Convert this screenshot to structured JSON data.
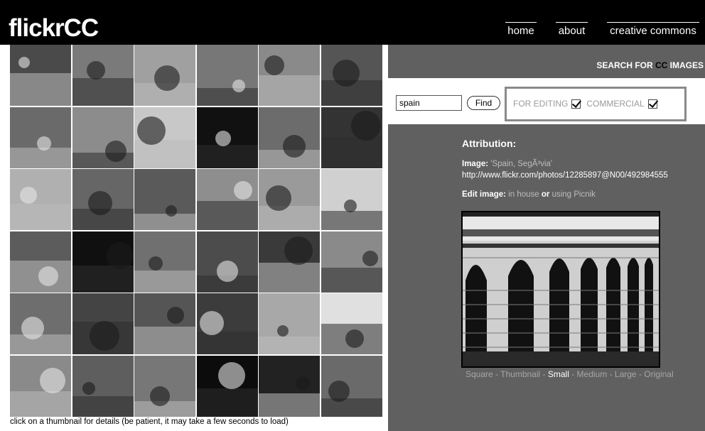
{
  "header": {
    "logo": "flickrCC",
    "nav": [
      {
        "label": "home"
      },
      {
        "label": "about"
      },
      {
        "label": "creative commons"
      }
    ]
  },
  "gallery": {
    "footer_note": "click on a thumbnail for details (be patient, it may take a few seconds to load)",
    "tiles": [
      {
        "tone": "#4a4a4a"
      },
      {
        "tone": "#7a7a7a"
      },
      {
        "tone": "#a0a0a0"
      },
      {
        "tone": "#777777"
      },
      {
        "tone": "#8a8a8a"
      },
      {
        "tone": "#555555"
      },
      {
        "tone": "#6a6a6a"
      },
      {
        "tone": "#8c8c8c"
      },
      {
        "tone": "#c8c8c8"
      },
      {
        "tone": "#111111"
      },
      {
        "tone": "#6c6c6c"
      },
      {
        "tone": "#333333"
      },
      {
        "tone": "#b0b0b0"
      },
      {
        "tone": "#666666"
      },
      {
        "tone": "#5a5a5a"
      },
      {
        "tone": "#8e8e8e"
      },
      {
        "tone": "#9a9a9a"
      },
      {
        "tone": "#d0d0d0"
      },
      {
        "tone": "#5c5c5c"
      },
      {
        "tone": "#101010"
      },
      {
        "tone": "#707070"
      },
      {
        "tone": "#4c4c4c"
      },
      {
        "tone": "#3a3a3a"
      },
      {
        "tone": "#8a8a8a"
      },
      {
        "tone": "#6e6e6e"
      },
      {
        "tone": "#444444"
      },
      {
        "tone": "#555555"
      },
      {
        "tone": "#3c3c3c"
      },
      {
        "tone": "#a8a8a8"
      },
      {
        "tone": "#e0e0e0"
      },
      {
        "tone": "#8a8a8a"
      },
      {
        "tone": "#5e5e5e"
      },
      {
        "tone": "#777777"
      },
      {
        "tone": "#0c0c0c"
      },
      {
        "tone": "#222222"
      },
      {
        "tone": "#6a6a6a"
      }
    ]
  },
  "search": {
    "heading_prefix": "SEARCH FOR ",
    "heading_cc": "CC",
    "heading_suffix": " IMAGES",
    "query": "spain",
    "find_label": "Find",
    "for_editing_label": "FOR EDITING",
    "for_editing_checked": true,
    "commercial_label": "COMMERCIAL",
    "commercial_checked": true
  },
  "attribution": {
    "title": "Attribution:",
    "image_label": "Image: ",
    "image_title": "'Spain, SegÃ³via'",
    "url": "http://www.flickr.com/photos/12285897@N00/492984555",
    "edit_label": "Edit image: ",
    "edit_in_house": "in house",
    "edit_or": " or ",
    "edit_picnik": "using Picnik"
  },
  "sizes": {
    "square": "Square",
    "thumbnail": "Thumbnail",
    "small": "Small",
    "medium": "Medium",
    "large": "Large",
    "original": "Original",
    "separator": " - ",
    "selected": "small"
  },
  "colors": {
    "topbar": "#000000",
    "panel": "#606060",
    "link": "#bdbdbd"
  }
}
